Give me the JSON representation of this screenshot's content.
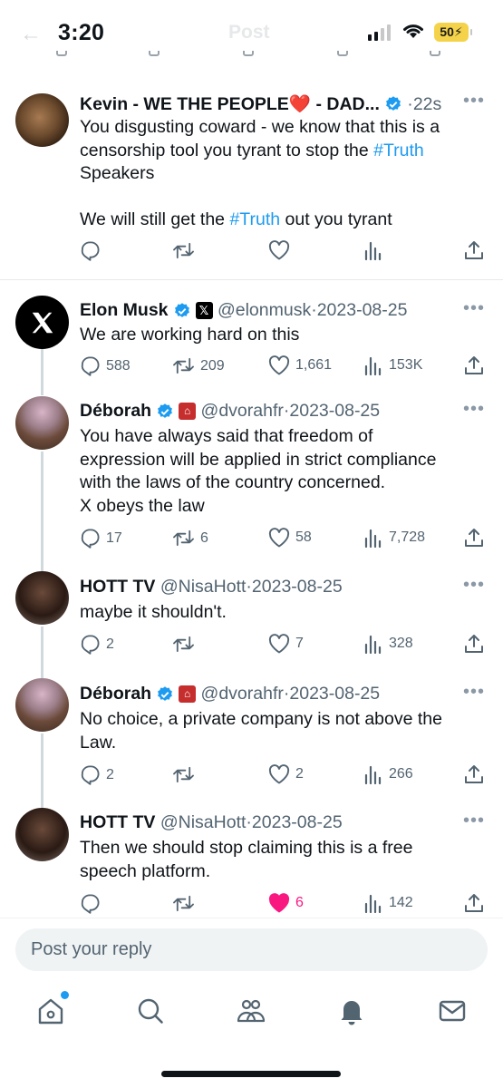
{
  "status_bar": {
    "time": "3:20",
    "battery": "50"
  },
  "header": {
    "title": "Post"
  },
  "posts": [
    {
      "name": "Kevin - WE THE PEOPLE❤️ - DAD...",
      "handle": "",
      "time": "22s",
      "lines": [
        "You disgusting coward - we know that this is a",
        "censorship tool you tyrant to stop the ",
        "#Truth",
        "Speakers",
        "We will still get the ",
        "#Truth",
        " out you tyrant"
      ],
      "counts": {
        "replies": "",
        "reposts": "",
        "likes": "",
        "views": ""
      }
    },
    {
      "name": "Elon Musk",
      "handle": "@elonmusk",
      "time": "2023-08-25",
      "lines": [
        "We are working hard on this"
      ],
      "counts": {
        "replies": "588",
        "reposts": "209",
        "likes": "1,661",
        "views": "153K"
      }
    },
    {
      "name": "Déborah",
      "handle": "@dvorahfr",
      "time": "2023-08-25",
      "lines": [
        "You have always said that freedom of",
        "expression will be applied in strict compliance",
        "with the laws of the country concerned.",
        "X obeys the law"
      ],
      "counts": {
        "replies": "17",
        "reposts": "6",
        "likes": "58",
        "views": "7,728"
      }
    },
    {
      "name": "HOTT TV",
      "handle": "@NisaHott",
      "time": "2023-08-25",
      "lines": [
        "maybe it shouldn't."
      ],
      "counts": {
        "replies": "2",
        "reposts": "",
        "likes": "7",
        "views": "328"
      }
    },
    {
      "name": "Déborah",
      "handle": "@dvorahfr",
      "time": "2023-08-25",
      "lines": [
        "No choice, a private company is not above the",
        "Law."
      ],
      "counts": {
        "replies": "2",
        "reposts": "",
        "likes": "2",
        "views": "266"
      }
    },
    {
      "name": "HOTT TV",
      "handle": "@NisaHott",
      "time": "2023-08-25",
      "lines": [
        "Then we should stop claiming this is a free",
        "speech platform."
      ],
      "counts": {
        "replies": "",
        "reposts": "",
        "likes": "6",
        "views": "142"
      }
    }
  ],
  "reply": {
    "placeholder": "Post your reply"
  },
  "icons": {
    "nav": [
      "home-icon",
      "search-icon",
      "communities-icon",
      "notifications-icon",
      "messages-icon"
    ],
    "actions": [
      "reply-icon",
      "repost-icon",
      "like-icon",
      "views-icon",
      "share-icon"
    ]
  },
  "colors": {
    "link": "#1d9bf0",
    "liked": "#f91880",
    "verified": "#1d9bf0",
    "battery": "#f4d34a"
  }
}
